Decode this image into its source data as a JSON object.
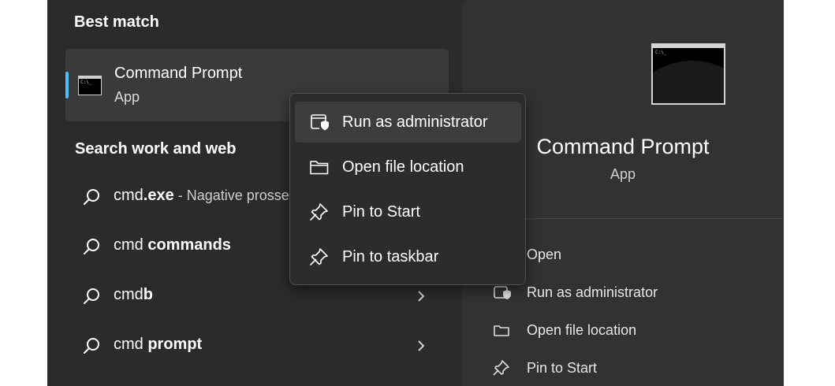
{
  "left": {
    "best_match_title": "Best match",
    "best_match": {
      "title": "Command Prompt",
      "subtitle": "App",
      "icon": "cmd-icon"
    },
    "search_web_title": "Search work and web",
    "results": [
      {
        "prefix": "cmd",
        "bold": ".exe",
        "desc": " - Nagative prosse",
        "icon": "search-icon"
      },
      {
        "prefix": "cmd ",
        "bold": "commands",
        "desc": "",
        "icon": "search-icon"
      },
      {
        "prefix": "cmd",
        "bold": "b",
        "desc": "",
        "icon": "search-icon",
        "chevron": "chevron-right-icon"
      },
      {
        "prefix": "cmd ",
        "bold": "prompt",
        "desc": "",
        "icon": "search-icon",
        "chevron": "chevron-right-icon"
      }
    ]
  },
  "context_menu": {
    "items": [
      {
        "label": "Run as administrator",
        "icon": "shield-icon",
        "highlighted": true
      },
      {
        "label": "Open file location",
        "icon": "folder-icon"
      },
      {
        "label": "Pin to Start",
        "icon": "pin-icon"
      },
      {
        "label": "Pin to taskbar",
        "icon": "pin-icon"
      }
    ]
  },
  "preview": {
    "title": "Command Prompt",
    "subtitle": "App",
    "icon": "cmd-icon",
    "actions": [
      {
        "label": "Open",
        "icon": "open-icon"
      },
      {
        "label": "Run as administrator",
        "icon": "shield-icon"
      },
      {
        "label": "Open file location",
        "icon": "folder-icon"
      },
      {
        "label": "Pin to Start",
        "icon": "pin-icon"
      }
    ]
  },
  "colors": {
    "panel": "#2b2b2b",
    "preview": "#323232",
    "accent": "#4cc2ff",
    "menu": "#2c2c2c"
  }
}
